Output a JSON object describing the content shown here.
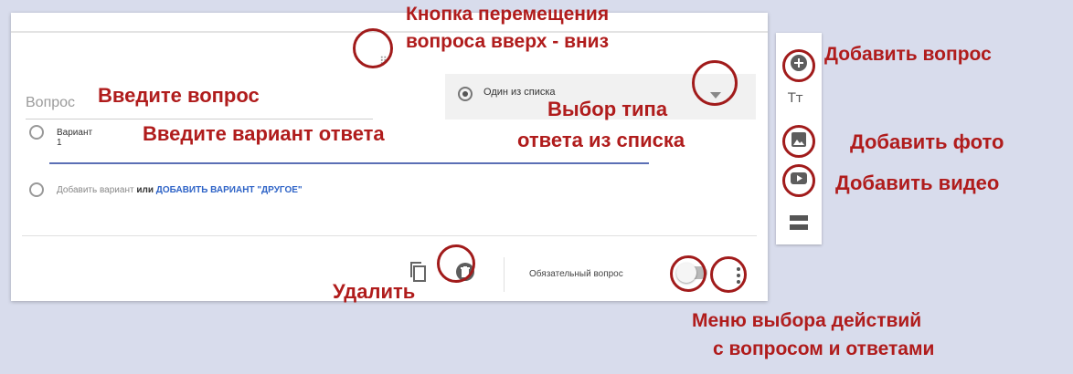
{
  "question": {
    "placeholder": "Вопрос"
  },
  "type_select": {
    "value": "Один из списка"
  },
  "options": [
    {
      "label": "Вариант 1"
    }
  ],
  "add_option": {
    "add_label": "Добавить вариант",
    "or_label": "или",
    "other_label": "ДОБАВИТЬ ВАРИАНТ \"ДРУГОЕ\""
  },
  "footer": {
    "required_label": "Обязательный вопрос",
    "required_on": false
  },
  "toolbar": {
    "title_icon_text": "Тт"
  },
  "annotations": {
    "drag": [
      "Кнопка перемещения",
      "вопроса вверх - вниз"
    ],
    "enter_question": "Введите вопрос",
    "enter_option": "Введите вариант ответа",
    "type_choice": [
      "Выбор типа",
      "ответа из списка"
    ],
    "add_question": "Добавить вопрос",
    "add_photo": "Добавить фото",
    "add_video": "Добавить видео",
    "delete": "Удалить",
    "menu": [
      "Меню выбора действий",
      "с вопросом и ответами"
    ]
  },
  "colors": {
    "annotation": "#b01c1c",
    "link": "#2f64c7",
    "underline": "#5b6fb5",
    "background": "#d8dcec"
  },
  "icons": [
    "drag-handle-icon",
    "radio-icon",
    "chevron-down-icon",
    "copy-icon",
    "trash-icon",
    "more-vert-icon",
    "add-circle-icon",
    "title-icon",
    "image-icon",
    "video-icon",
    "section-icon"
  ]
}
